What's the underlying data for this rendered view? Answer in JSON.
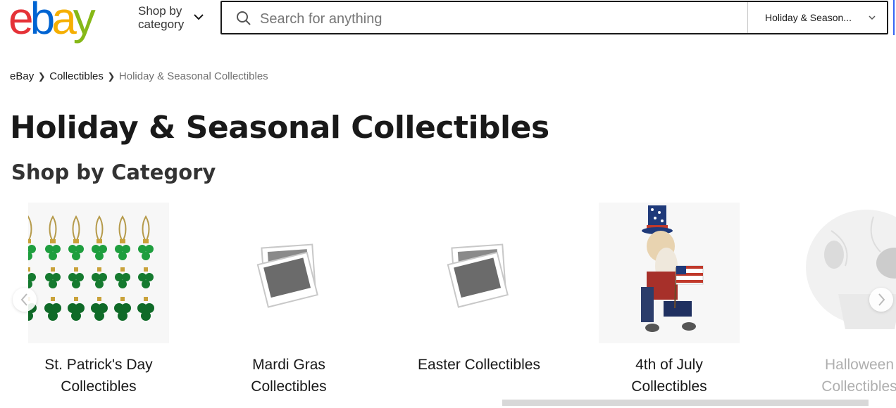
{
  "header": {
    "logo_letters": [
      "e",
      "b",
      "a",
      "y"
    ],
    "logo_colors": [
      "#e53238",
      "#0064d2",
      "#f5af02",
      "#86b817"
    ],
    "shop_by_line1": "Shop by",
    "shop_by_line2": "category",
    "search_placeholder": "Search for anything",
    "category_select": "Holiday & Season..."
  },
  "breadcrumb": {
    "items": [
      "eBay",
      "Collectibles",
      "Holiday & Seasonal Collectibles"
    ]
  },
  "page_title": "Holiday & Seasonal Collectibles",
  "section_title": "Shop by Category",
  "categories": [
    {
      "line1": "St. Patrick's Day",
      "line2": "Collectibles",
      "image": "green-shamrock-ornaments"
    },
    {
      "line1": "Mardi Gras",
      "line2": "Collectibles",
      "image": "placeholder-photo-icon"
    },
    {
      "line1": "Easter Collectibles",
      "line2": "",
      "image": "placeholder-photo-icon"
    },
    {
      "line1": "4th of July",
      "line2": "Collectibles",
      "image": "uncle-sam-figurine"
    },
    {
      "line1": "Halloween",
      "line2": "Collectibles",
      "image": "white-skull"
    }
  ],
  "icons": {
    "search": "search-icon",
    "chevron": "chevron-down-icon",
    "prev": "chevron-left-icon",
    "next": "chevron-right-icon"
  }
}
